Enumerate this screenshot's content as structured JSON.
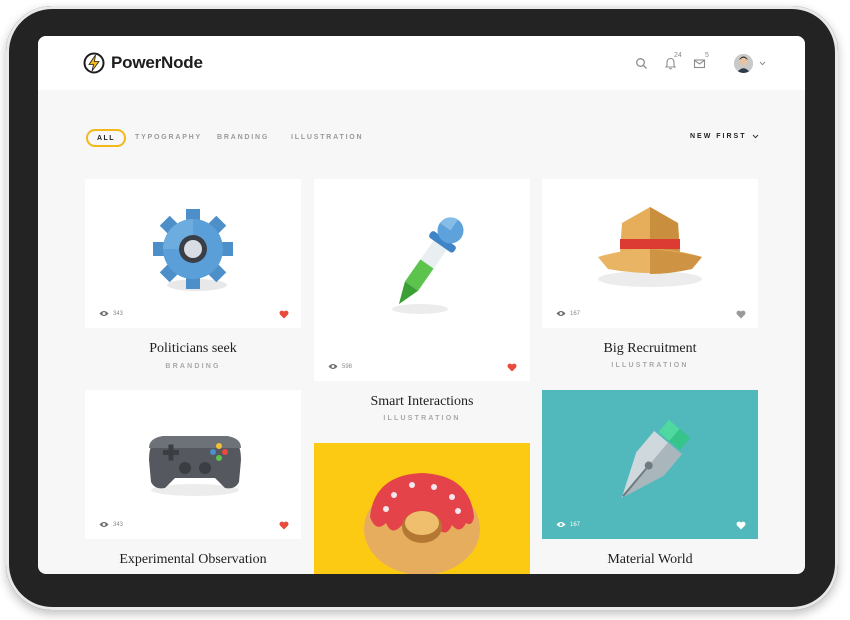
{
  "app": {
    "brand": "PowerNode"
  },
  "header": {
    "notifications_count": "24",
    "messages_count": "5"
  },
  "filters": {
    "items": [
      "ALL",
      "TYPOGRAPHY",
      "BRANDING",
      "ILLUSTRATION"
    ],
    "active": "ALL"
  },
  "sort": {
    "label": "NEW FIRST"
  },
  "cards": [
    {
      "title": "Politicians seek",
      "category": "BRANDING",
      "views": "343",
      "liked": true,
      "icon": "gear-icon"
    },
    {
      "title": "Smart Interactions",
      "category": "ILLUSTRATION",
      "views": "598",
      "liked": true,
      "icon": "pipette-icon"
    },
    {
      "title": "Big Recruitment",
      "category": "ILLUSTRATION",
      "views": "167",
      "liked": false,
      "icon": "hat-icon"
    },
    {
      "title": "Experimental Observation",
      "category": "",
      "views": "343",
      "liked": true,
      "icon": "gamepad-icon"
    },
    {
      "title": "",
      "category": "",
      "views": "",
      "liked": false,
      "icon": "donut-icon"
    },
    {
      "title": "Material World",
      "category": "",
      "views": "167",
      "liked": false,
      "icon": "pen-nib-icon"
    }
  ],
  "colors": {
    "accent": "#f2b81c",
    "like": "#e84a3b",
    "teal": "#51b8bb",
    "yellow": "#fcca12"
  }
}
